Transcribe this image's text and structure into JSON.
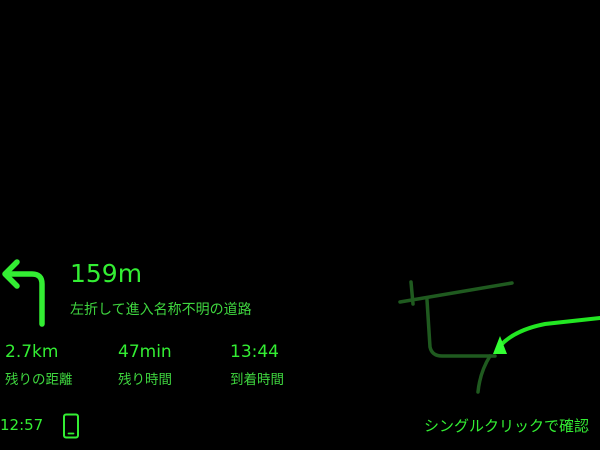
{
  "navigation": {
    "maneuver_icon": "turn-left-arrow-icon",
    "distance": "159m",
    "instruction": "左折して進入名称不明の道路"
  },
  "stats": [
    {
      "value": "2.7km",
      "label": "残りの距離"
    },
    {
      "value": "47min",
      "label": "残り時間"
    },
    {
      "value": "13:44",
      "label": "到着時間"
    }
  ],
  "status_bar": {
    "clock": "12:57",
    "device_icon": "phone-icon",
    "hint": "シングルクリックで確認"
  },
  "colors": {
    "background": "#000000",
    "primary": "#33ee33",
    "route": "#22e622",
    "minor_road": "#1f5a1f",
    "position_marker": "#33ff33"
  }
}
